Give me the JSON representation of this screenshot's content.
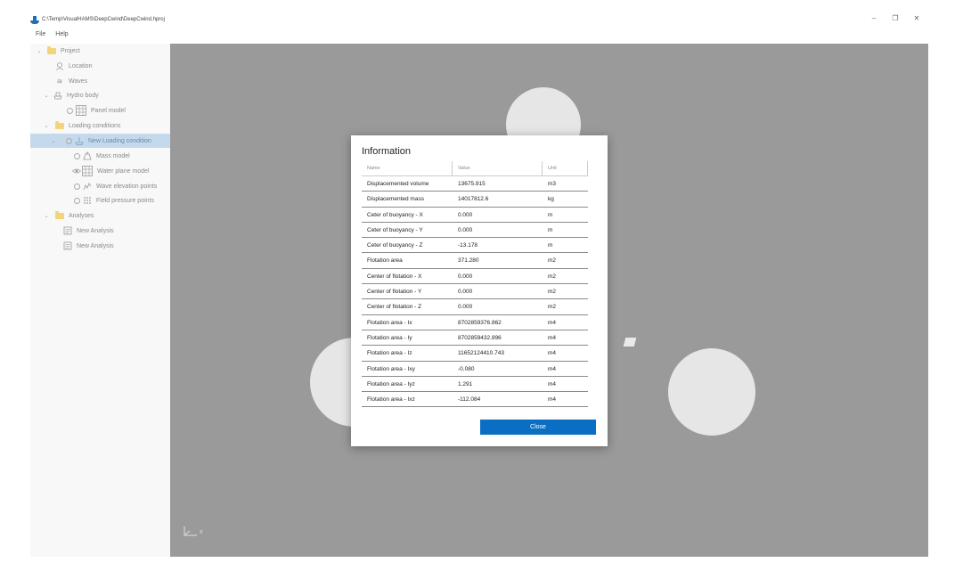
{
  "window": {
    "title": "C:\\Temp\\VisualHAMS\\DeepCwind\\DeepCwind.hproj",
    "minimize": "–",
    "restore": "❐",
    "close": "✕"
  },
  "menu": {
    "items": [
      "File",
      "Help"
    ]
  },
  "tree": {
    "items": [
      {
        "label": "Project",
        "icon": "folder-icon",
        "chev": "⌄"
      },
      {
        "label": "Location",
        "icon": "location-icon"
      },
      {
        "label": "Waves",
        "icon": "waves-icon"
      },
      {
        "label": "Hydro body",
        "icon": "hydro-body-icon",
        "chev": "⌄"
      },
      {
        "label": "Panel model",
        "icon": "panel-model-icon"
      },
      {
        "label": "Loading conditions",
        "icon": "folder-icon",
        "chev": "⌄"
      },
      {
        "label": "New Loading condition",
        "icon": "loading-condition-icon",
        "chev": "⌄"
      },
      {
        "label": "Mass model",
        "icon": "mass-model-icon"
      },
      {
        "label": "Water plane model",
        "icon": "water-plane-icon"
      },
      {
        "label": "Wave elevation points",
        "icon": "wave-elevation-icon"
      },
      {
        "label": "Field pressure points",
        "icon": "field-pressure-icon"
      },
      {
        "label": "Analyses",
        "icon": "folder-icon",
        "chev": "⌄"
      },
      {
        "label": "New Analysis",
        "icon": "analysis-icon"
      },
      {
        "label": "New Analysis",
        "icon": "analysis-icon"
      }
    ]
  },
  "viewport": {
    "axis_label": "x"
  },
  "dialog": {
    "title": "Information",
    "columns": [
      "Name",
      "Value",
      "Unit"
    ],
    "rows": [
      [
        "Displacemented volume",
        "13675.915",
        "m3"
      ],
      [
        "Displacemented mass",
        "14017812.6",
        "kg"
      ],
      [
        "Ceter of buoyancy - X",
        "0.000",
        "m"
      ],
      [
        "Ceter of buoyancy - Y",
        "0.000",
        "m"
      ],
      [
        "Ceter of buoyancy - Z",
        "-13.178",
        "m"
      ],
      [
        "Flotation area",
        "371.280",
        "m2"
      ],
      [
        "Center of flotation - X",
        "0.000",
        "m2"
      ],
      [
        "Center of flotation - Y",
        "0.000",
        "m2"
      ],
      [
        "Center of flotation - Z",
        "0.000",
        "m2"
      ],
      [
        "Flotation area - Ix",
        "8702859376.862",
        "m4"
      ],
      [
        "Flotation area - Iy",
        "8702859432.896",
        "m4"
      ],
      [
        "Flotation area - Iz",
        "11652124410.743",
        "m4"
      ],
      [
        "Flotation area - Ixy",
        "-0.080",
        "m4"
      ],
      [
        "Flotation area - Iyz",
        "1.291",
        "m4"
      ],
      [
        "Flotation area - Ixz",
        "-112.084",
        "m4"
      ]
    ],
    "close_label": "Close"
  },
  "colors": {
    "accent": "#0a6fc2",
    "selection": "#c4d9ec",
    "viewport": "#9a9a9a"
  }
}
